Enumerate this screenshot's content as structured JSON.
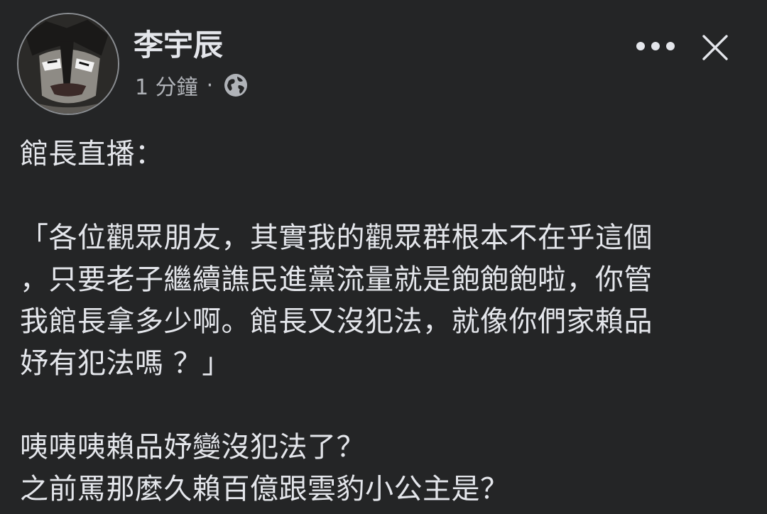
{
  "post": {
    "author_name": "李宇辰",
    "timestamp": "1 分鐘",
    "separator": "·",
    "audience_icon": "globe-icon",
    "avatar_icon": "avatar-image",
    "more_icon": "more-dots-icon",
    "close_icon": "close-icon"
  },
  "content": {
    "paragraph_1": "館長直播：",
    "paragraph_2_lines": [
      "「各位觀眾朋友，其實我的觀眾群根本不在乎這個",
      "，只要老子繼續譙民進黨流量就是飽飽飽啦，你管",
      "我館長拿多少啊。館長又沒犯法，就像你們家賴品",
      "妤有犯法嗎 ？」"
    ],
    "paragraph_3_lines": [
      "咦咦咦賴品妤變沒犯法了？",
      "之前罵那麼久賴百億跟雲豹小公主是？"
    ]
  },
  "colors": {
    "background": "#242526",
    "primary_text": "#e4e6eb",
    "secondary_text": "#b0b3b8"
  }
}
